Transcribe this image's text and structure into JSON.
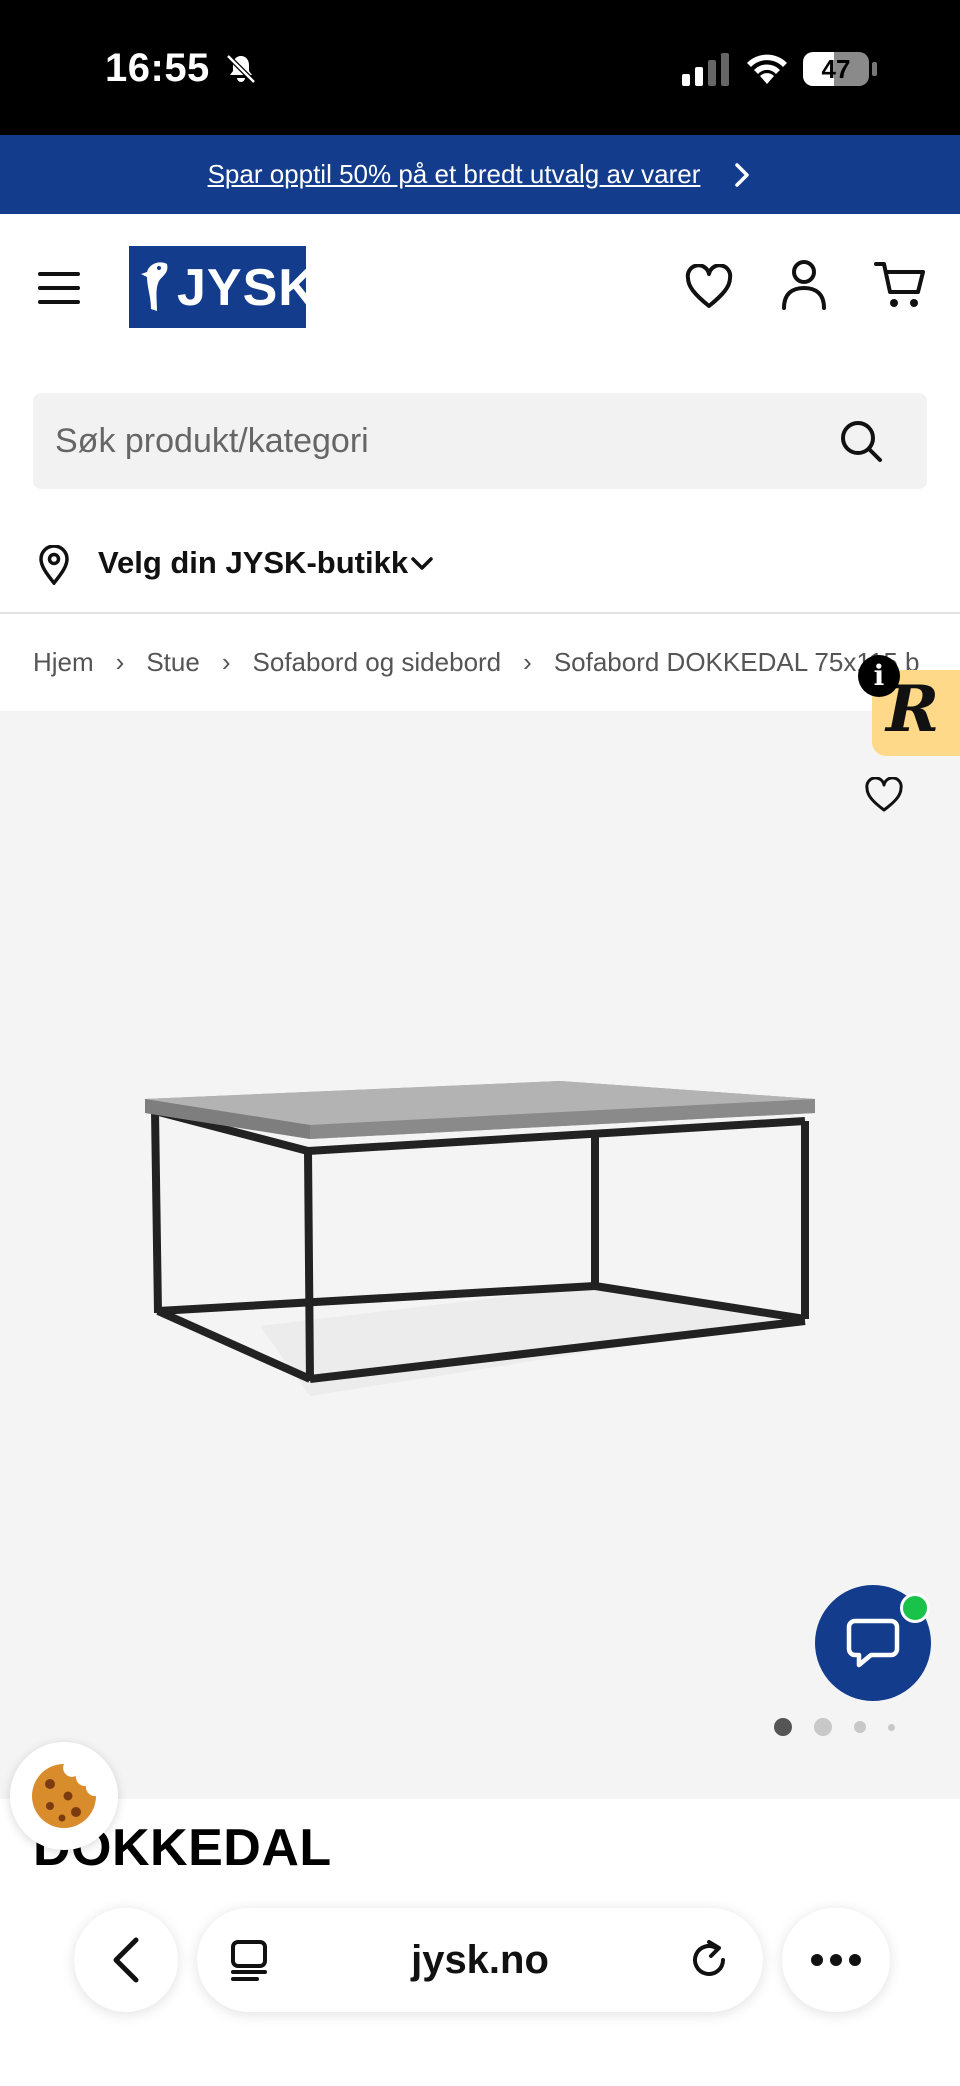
{
  "status_bar": {
    "time": "16:55",
    "battery": "47",
    "battery_fraction": 0.47
  },
  "promo": {
    "text": "Spar opptil 50% på et bredt utvalg av varer"
  },
  "header": {
    "logo_text": "JYSK"
  },
  "search": {
    "placeholder": "Søk produkt/kategori"
  },
  "store": {
    "label": "Velg din JYSK-butikk"
  },
  "breadcrumb": {
    "items": [
      "Hjem",
      "Stue",
      "Sofabord og sidebord",
      "Sofabord DOKKEDAL 75x115 b"
    ]
  },
  "gallery": {
    "image_count": 4,
    "active_index": 0
  },
  "badge": {
    "letter": "R",
    "info": "i"
  },
  "product": {
    "title": "DOKKEDAL"
  },
  "browser": {
    "url": "jysk.no"
  },
  "colors": {
    "brand_blue": "#143c8c",
    "online_green": "#19c34a",
    "badge_yellow": "#ffd98a"
  }
}
